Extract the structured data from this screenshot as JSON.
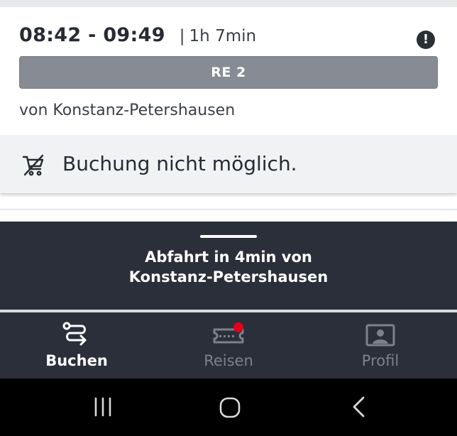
{
  "journey": {
    "times": "08:42 - 09:49",
    "separator": "|",
    "duration": "1h 7min",
    "alert_symbol": "!",
    "train": "RE 2",
    "origin": "von Konstanz-Petershausen"
  },
  "notice": {
    "text": "Buchung nicht möglich.",
    "icon": "cart-crossed-icon"
  },
  "departure_sheet": {
    "line1": "Abfahrt in 4min von",
    "line2": "Konstanz-Petershausen"
  },
  "nav": {
    "items": [
      {
        "label": "Buchen",
        "icon": "route-icon",
        "active": true
      },
      {
        "label": "Reisen",
        "icon": "ticket-icon",
        "active": false,
        "badge": true
      },
      {
        "label": "Profil",
        "icon": "profile-icon",
        "active": false
      }
    ]
  },
  "colors": {
    "badge": "#e2001a",
    "dark_bar": "#2b2f39",
    "train_bar": "#878b93"
  }
}
